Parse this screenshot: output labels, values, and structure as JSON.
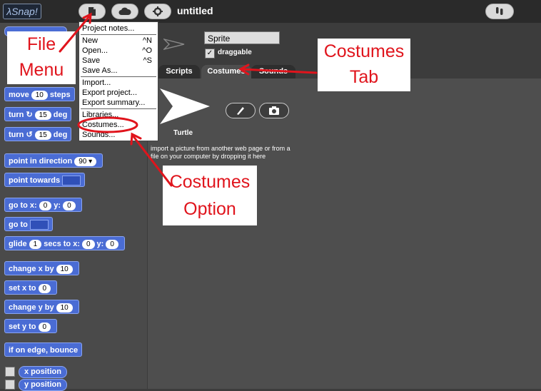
{
  "app": {
    "logo_text": "λSnap!",
    "project_title": "untitled"
  },
  "file_menu": {
    "items": [
      {
        "label": "Project notes...",
        "shortcut": ""
      },
      {
        "label": "New",
        "shortcut": "^N"
      },
      {
        "label": "Open...",
        "shortcut": "^O"
      },
      {
        "label": "Save",
        "shortcut": "^S"
      },
      {
        "label": "Save As...",
        "shortcut": ""
      },
      {
        "label": "Import...",
        "shortcut": ""
      },
      {
        "label": "Export project...",
        "shortcut": ""
      },
      {
        "label": "Export summary...",
        "shortcut": ""
      },
      {
        "label": "Libraries...",
        "shortcut": ""
      },
      {
        "label": "Costumes...",
        "shortcut": ""
      },
      {
        "label": "Sounds...",
        "shortcut": ""
      }
    ]
  },
  "palette": {
    "blocks": {
      "move": {
        "pre": "move",
        "val": "10",
        "post": "steps"
      },
      "turn_cw": {
        "pre": "turn",
        "val": "15",
        "post": "deg"
      },
      "turn_ccw": {
        "pre": "turn",
        "val": "15",
        "post": "deg"
      },
      "point_dir": {
        "pre": "point in direction",
        "val": "90 ▾"
      },
      "point_towards": {
        "pre": "point towards"
      },
      "goto_xy": {
        "pre": "go to x:",
        "x": "0",
        "mid": "y:",
        "y": "0"
      },
      "goto": {
        "pre": "go to"
      },
      "glide": {
        "pre": "glide",
        "secs": "1",
        "mid1": "secs to x:",
        "x": "0",
        "mid2": "y:",
        "y": "0"
      },
      "change_x": {
        "pre": "change x by",
        "val": "10"
      },
      "set_x": {
        "pre": "set x to",
        "val": "0"
      },
      "change_y": {
        "pre": "change y by",
        "val": "10"
      },
      "set_y": {
        "pre": "set y to",
        "val": "0"
      },
      "bounce": {
        "pre": "if on edge, bounce"
      },
      "x_position": {
        "pre": "x position"
      },
      "y_position": {
        "pre": "y position"
      }
    }
  },
  "sprite": {
    "name": "Sprite",
    "draggable_label": "draggable",
    "draggable_check": "✓"
  },
  "tabs": {
    "scripts": "Scripts",
    "costumes": "Costumes",
    "sounds": "Sounds"
  },
  "costumes": {
    "turtle_label": "Turtle",
    "hint": "import a picture from another web page or from a file on your computer by dropping it here"
  },
  "annotations": {
    "file_menu_1": "File",
    "file_menu_2": "Menu",
    "costumes_tab_1": "Costumes",
    "costumes_tab_2": "Tab",
    "costumes_option_1": "Costumes",
    "costumes_option_2": "Option",
    "accent_red": "#e0141c"
  }
}
